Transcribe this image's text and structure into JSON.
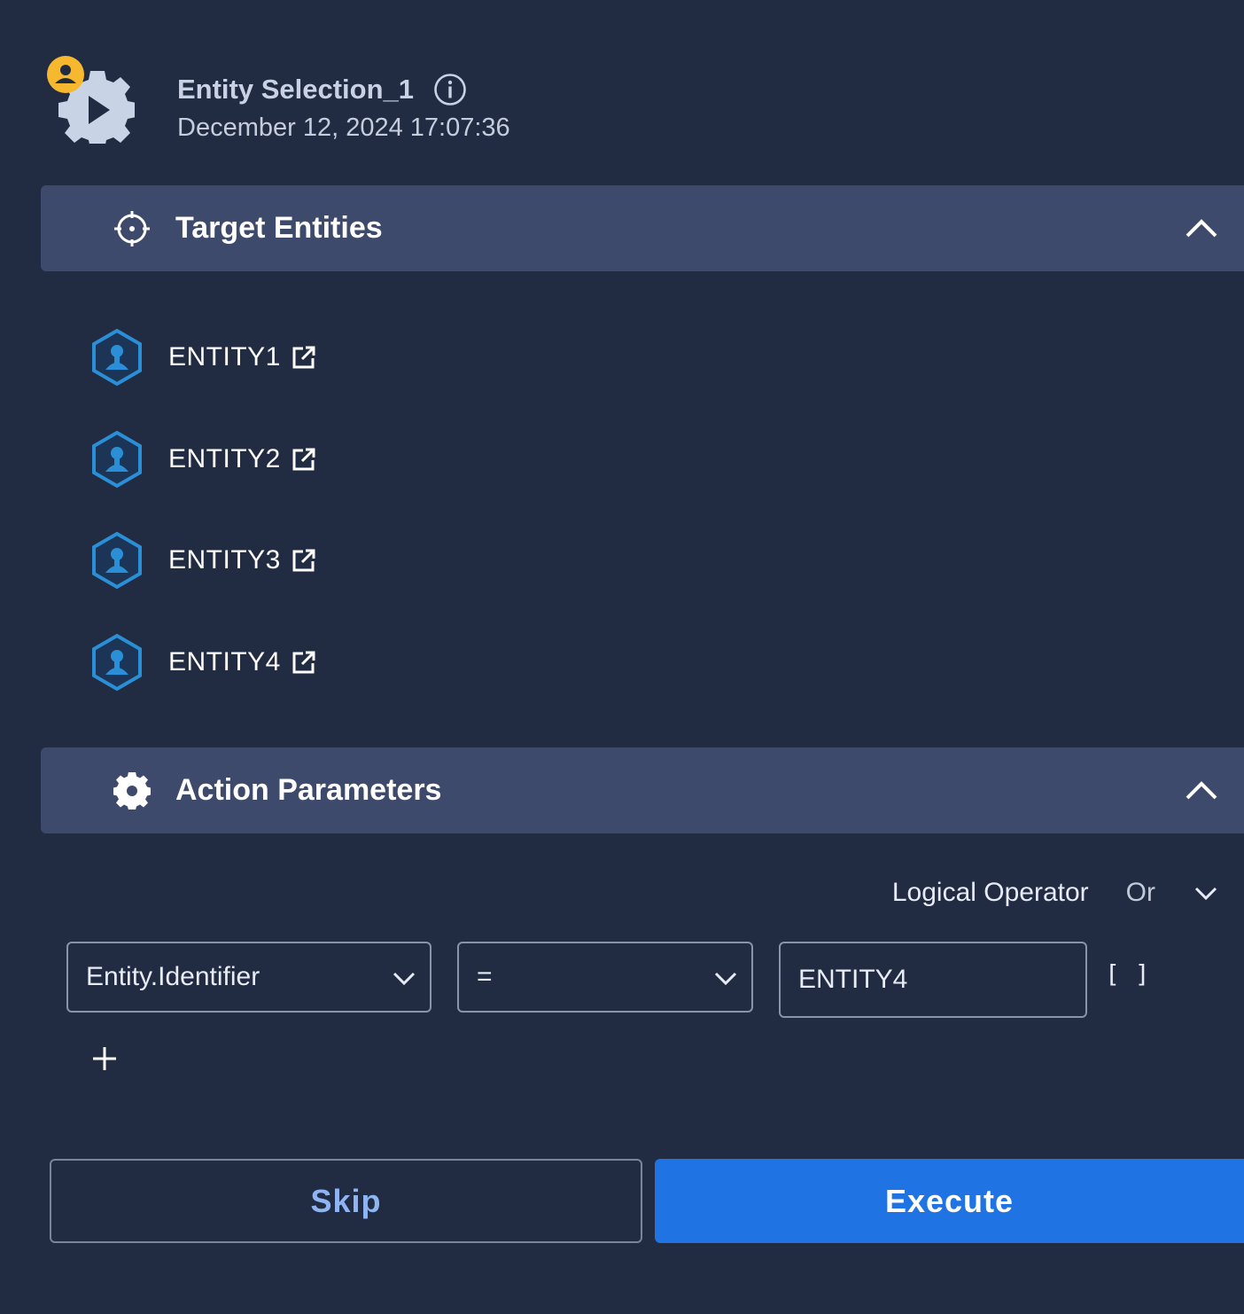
{
  "header": {
    "title": "Entity Selection_1",
    "timestamp": "December 12, 2024 17:07:36",
    "icon": "gear-play-icon",
    "badge_icon": "user-badge-icon",
    "info_icon": "info-icon"
  },
  "target_entities": {
    "title": "Target Entities",
    "icon": "crosshair-icon",
    "expanded": true,
    "items": [
      {
        "label": "ENTITY1"
      },
      {
        "label": "ENTITY2"
      },
      {
        "label": "ENTITY3"
      },
      {
        "label": "ENTITY4"
      }
    ]
  },
  "action_parameters": {
    "title": "Action Parameters",
    "icon": "gear-icon",
    "expanded": true,
    "logical_operator_label": "Logical Operator",
    "logical_operator_value": "Or",
    "condition": {
      "field": "Entity.Identifier",
      "operator": "=",
      "value": "ENTITY4",
      "brackets_label": "[ ]"
    }
  },
  "actions": {
    "skip_label": "Skip",
    "execute_label": "Execute"
  },
  "colors": {
    "background": "#212b42",
    "section_header": "#3d4a6b",
    "accent": "#1f73e3",
    "entity_icon": "#2a8fd6",
    "badge": "#f5b82e"
  }
}
